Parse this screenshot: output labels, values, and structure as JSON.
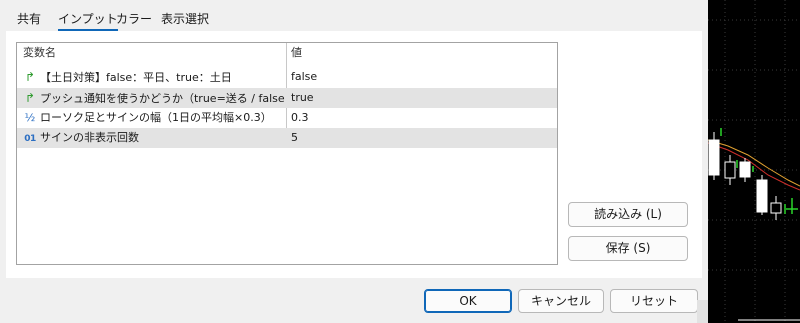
{
  "tabs": [
    {
      "label": "共有"
    },
    {
      "label": "インプット"
    },
    {
      "label": "カラー"
    },
    {
      "label": "表示選択"
    }
  ],
  "active_tab": "インプット",
  "grid": {
    "headers": {
      "name": "変数名",
      "value": "値"
    },
    "rows": [
      {
        "icon": "bool-arrow-icon",
        "name": "【土日対策】false：平日、true：土日",
        "value": "false"
      },
      {
        "icon": "bool-arrow-icon",
        "name": "プッシュ通知を使うかどうか（true=送る / false=...",
        "value": "true"
      },
      {
        "icon": "fraction-icon",
        "name": "ローソク足とサインの幅（1日の平均幅×0.3）",
        "value": "0.3"
      },
      {
        "icon": "integer-icon",
        "name": "サインの非表示回数",
        "value": "5"
      }
    ]
  },
  "side_buttons": {
    "load": "読み込み (L)",
    "save": "保存 (S)"
  },
  "footer_buttons": {
    "ok": "OK",
    "cancel": "キャンセル",
    "reset": "リセット"
  },
  "colors": {
    "accent": "#0f67b8",
    "bool_icon": "#2f9b2f",
    "numeric_icon": "#2b6ec2"
  }
}
